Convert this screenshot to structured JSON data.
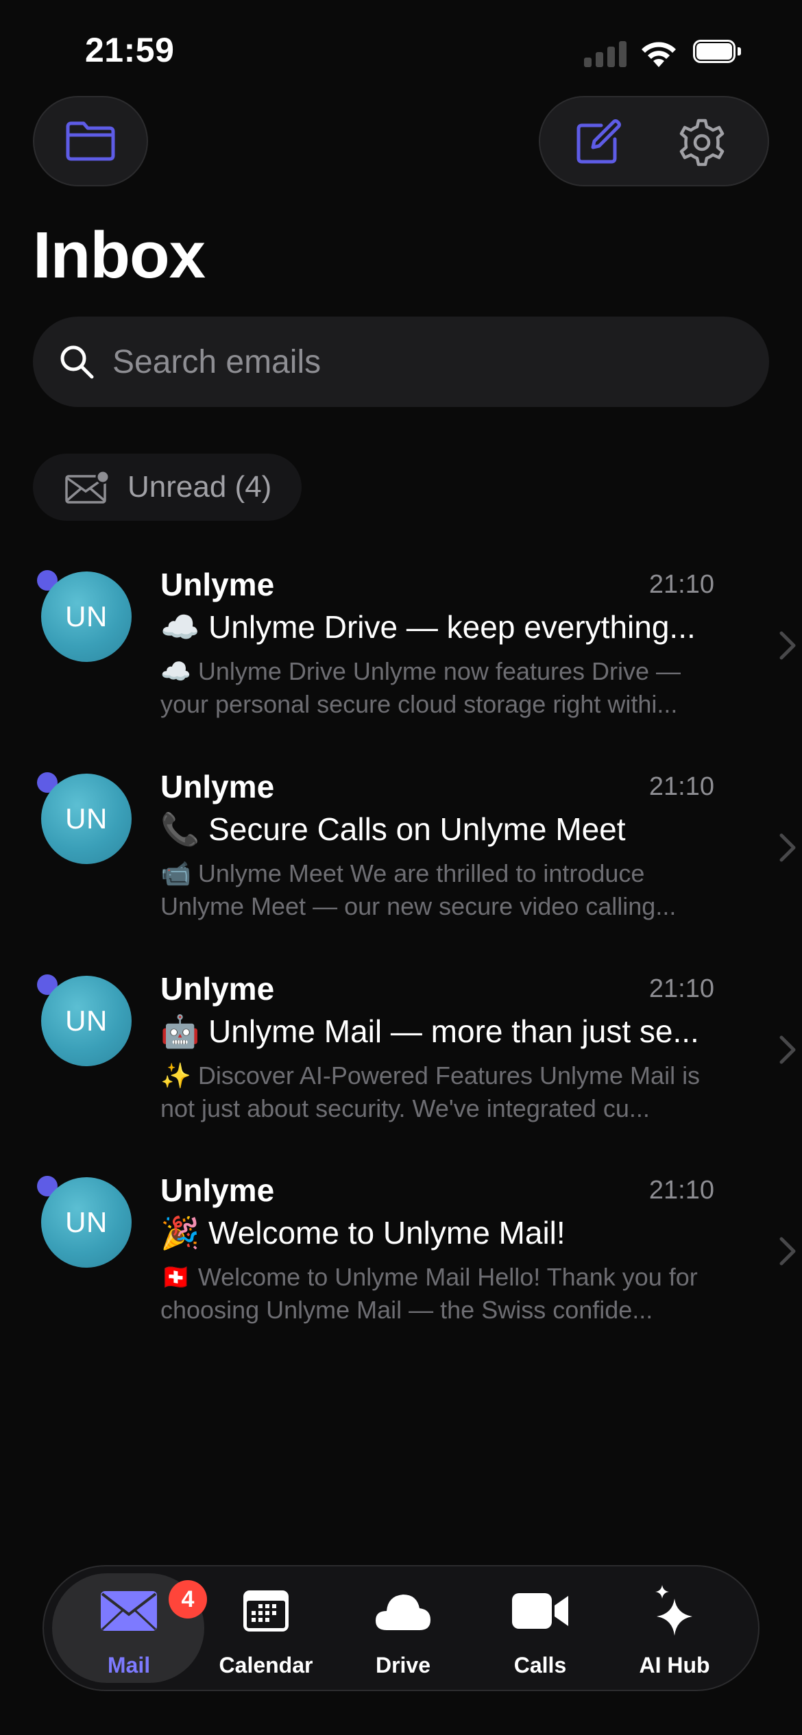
{
  "status_bar": {
    "time": "21:59"
  },
  "header": {
    "title": "Inbox",
    "accent_color": "#5e5ce6",
    "icons": {
      "folder": "folder-icon",
      "compose": "compose-icon",
      "settings": "gear-icon"
    }
  },
  "search": {
    "placeholder": "Search emails",
    "value": ""
  },
  "filter": {
    "label": "Unread (4)"
  },
  "emails": [
    {
      "sender": "Unlyme",
      "initials": "UN",
      "time": "21:10",
      "unread": true,
      "subject": "☁️ Unlyme Drive — keep everything...",
      "preview": "☁️ Unlyme Drive Unlyme now features Drive — your personal secure cloud storage right withi..."
    },
    {
      "sender": "Unlyme",
      "initials": "UN",
      "time": "21:10",
      "unread": true,
      "subject": "📞 Secure Calls on Unlyme Meet",
      "preview": "📹 Unlyme Meet We are thrilled to introduce Unlyme Meet — our new secure video calling..."
    },
    {
      "sender": "Unlyme",
      "initials": "UN",
      "time": "21:10",
      "unread": true,
      "subject": "🤖 Unlyme Mail — more than just se...",
      "preview": "✨ Discover AI-Powered Features Unlyme Mail is not just about security. We've integrated cu..."
    },
    {
      "sender": "Unlyme",
      "initials": "UN",
      "time": "21:10",
      "unread": true,
      "subject": "🎉 Welcome to Unlyme Mail!",
      "preview": "🇨🇭 Welcome to Unlyme Mail Hello! Thank you for choosing Unlyme Mail — the Swiss confide..."
    }
  ],
  "tabs": [
    {
      "label": "Mail",
      "icon": "mail-icon",
      "active": true,
      "badge": "4"
    },
    {
      "label": "Calendar",
      "icon": "calendar-icon",
      "active": false
    },
    {
      "label": "Drive",
      "icon": "cloud-icon",
      "active": false
    },
    {
      "label": "Calls",
      "icon": "video-camera-icon",
      "active": false
    },
    {
      "label": "AI Hub",
      "icon": "sparkles-icon",
      "active": false
    }
  ]
}
